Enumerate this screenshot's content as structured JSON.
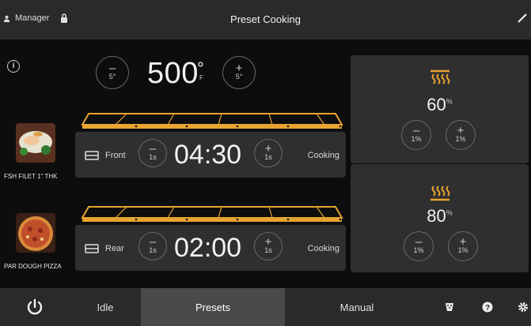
{
  "header": {
    "user": "Manager",
    "title": "Preset Cooking"
  },
  "temperature": {
    "value": "500",
    "degree": "°",
    "unit": "F",
    "step": "5°"
  },
  "zones": [
    {
      "product": "FSH FILET 1\" THK",
      "name": "Front",
      "time": "04:30",
      "step": "1s",
      "status": "Cooking"
    },
    {
      "product": "PAR DOUGH PIZZA",
      "name": "Rear",
      "time": "02:00",
      "step": "1s",
      "status": "Cooking"
    }
  ],
  "heaters": [
    {
      "icon": "top-heater-icon",
      "value": "60",
      "unit": "%",
      "step": "1%"
    },
    {
      "icon": "bottom-heater-icon",
      "value": "80",
      "unit": "%",
      "step": "1%"
    }
  ],
  "controls": {
    "minus": "–",
    "plus": "+"
  },
  "nav": {
    "idle": "Idle",
    "presets": "Presets",
    "manual": "Manual"
  },
  "colors": {
    "accent": "#e8a431",
    "background": "#0d0d0d",
    "panel": "#2f2f2f",
    "header": "#2a2a2a",
    "active_tab": "#4a4a4a"
  }
}
